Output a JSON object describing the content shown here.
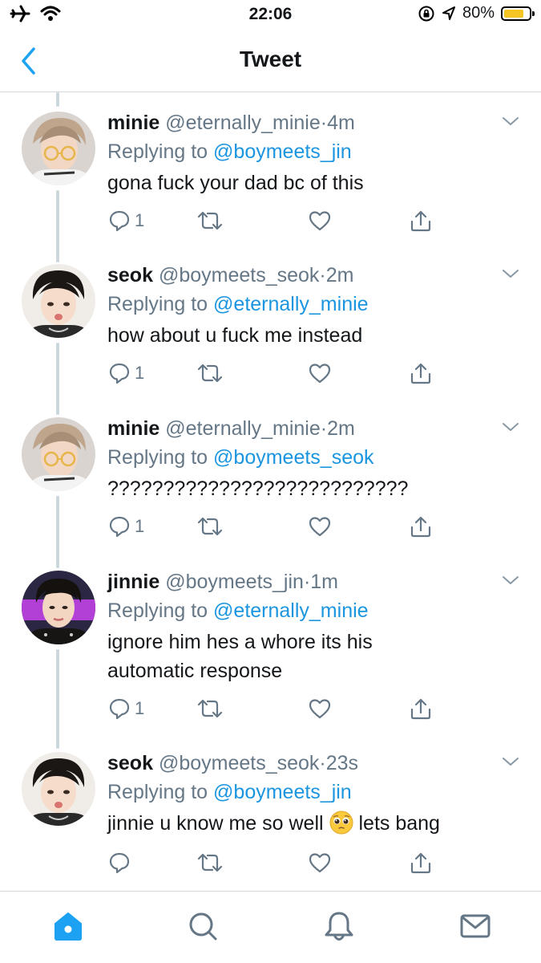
{
  "status_bar": {
    "time": "22:06",
    "battery_percent": "80%",
    "battery_level": 0.8,
    "battery_color": "#f5c523"
  },
  "nav": {
    "back_icon": "chevron-left-icon",
    "title": "Tweet"
  },
  "colors": {
    "link": "#1b95e0",
    "secondary_text": "#657786",
    "thread_line": "#ccd6dd",
    "tab_active": "#1da1f2"
  },
  "tweets": [
    {
      "display_name": "minie",
      "handle": "@eternally_minie",
      "separator": "·",
      "time": "4m",
      "replying_prefix": "Replying to",
      "replying_to": "@boymeets_jin",
      "text": "gona fuck your dad bc of this",
      "reply_count": "1"
    },
    {
      "display_name": "seok",
      "handle": "@boymeets_seok",
      "separator": "·",
      "time": "2m",
      "replying_prefix": "Replying to",
      "replying_to": "@eternally_minie",
      "text": "how about u fuck me instead",
      "reply_count": "1"
    },
    {
      "display_name": "minie",
      "handle": "@eternally_minie",
      "separator": "·",
      "time": "2m",
      "replying_prefix": "Replying to",
      "replying_to": "@boymeets_seok",
      "text": "???????????????????????????",
      "reply_count": "1"
    },
    {
      "display_name": "jinnie",
      "handle": "@boymeets_jin",
      "separator": "·",
      "time": "1m",
      "replying_prefix": "Replying to",
      "replying_to": "@eternally_minie",
      "text_line1": "ignore him hes a whore its his",
      "text_line2": "automatic response",
      "reply_count": "1"
    },
    {
      "display_name": "seok",
      "handle": "@boymeets_seok",
      "separator": "·",
      "time": "23s",
      "replying_prefix": "Replying to",
      "replying_to": "@boymeets_jin",
      "text_before_emoji": "jinnie u know me so well",
      "emoji": "pleading-face-emoji",
      "text_after_emoji": "lets bang",
      "reply_count": ""
    }
  ],
  "tab_bar": {
    "tabs": [
      {
        "icon": "home-icon",
        "active": true
      },
      {
        "icon": "search-icon",
        "active": false
      },
      {
        "icon": "bell-icon",
        "active": false
      },
      {
        "icon": "mail-icon",
        "active": false
      }
    ]
  }
}
